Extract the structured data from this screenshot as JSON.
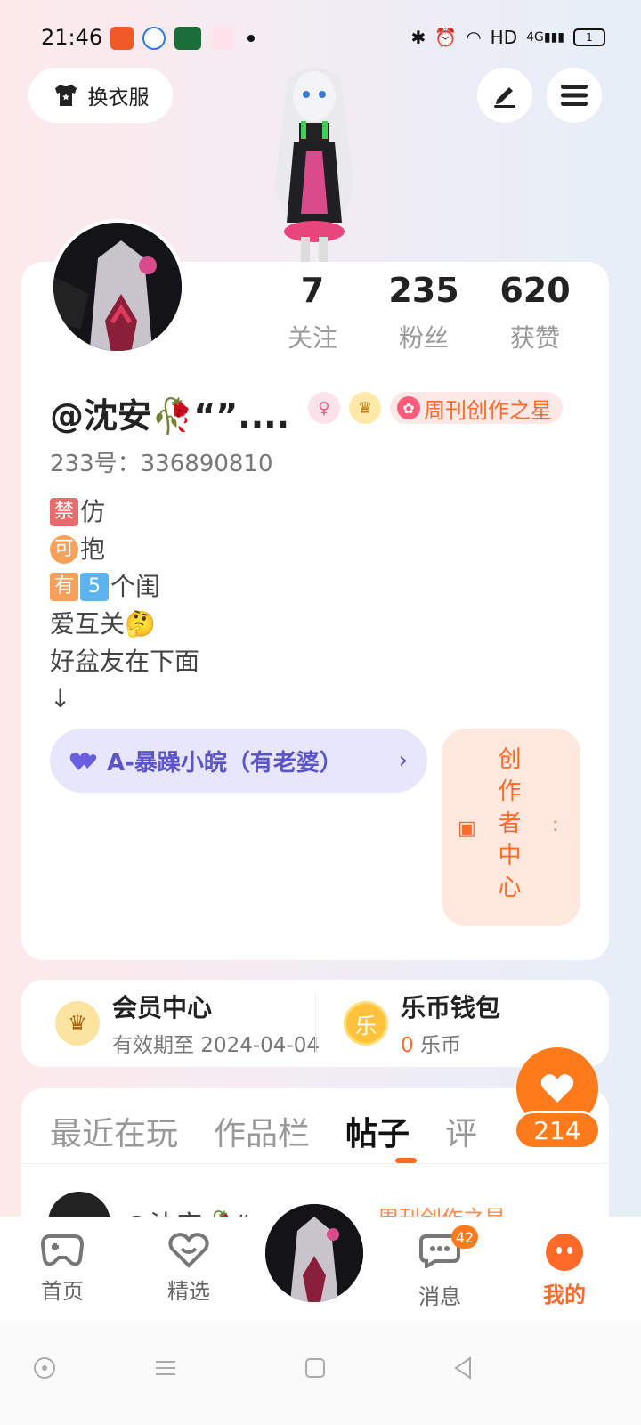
{
  "status_bar": {
    "time": "21:46",
    "network": "HD",
    "signal": "4G",
    "battery": "1"
  },
  "header": {
    "outfit_label": "换衣服"
  },
  "profile": {
    "stats": [
      {
        "value": "7",
        "label": "关注"
      },
      {
        "value": "235",
        "label": "粉丝"
      },
      {
        "value": "620",
        "label": "获赞"
      }
    ],
    "username": "@沈安🥀“”....",
    "badge_star": "周刊创作之星",
    "account_id": "233号：336890810",
    "bio": {
      "line1_tag": "禁",
      "line1_text": "仿",
      "line2_tag": "可",
      "line2_text": "抱",
      "line3_tag1": "有",
      "line3_tag2": "5",
      "line3_text": "个闺",
      "line4": "爱互关🤔",
      "line5": "好盆友在下面",
      "line6": "↓"
    },
    "couple_label": "A-暴躁小皖（有老婆）",
    "creator_center": "创作者中心"
  },
  "member": {
    "vip_title": "会员中心",
    "vip_sub": "有效期至 2024-04-04",
    "wallet_title": "乐币钱包",
    "wallet_amount": "0",
    "wallet_unit": "乐币",
    "coin_char": "乐"
  },
  "tabs": {
    "items": [
      "最近在玩",
      "作品栏",
      "帖子",
      "评"
    ],
    "active_index": 2,
    "peek_name": "@沈安🥀“",
    "peek_badge": "周刊创作之星"
  },
  "like_button": {
    "count": "214"
  },
  "bottom_nav": {
    "home": "首页",
    "featured": "精选",
    "messages": "消息",
    "messages_badge": "42",
    "mine": "我的"
  },
  "colors": {
    "accent": "#ff6a2b",
    "couple": "#5b55c9",
    "couple_bg": "#e8e6fb"
  }
}
